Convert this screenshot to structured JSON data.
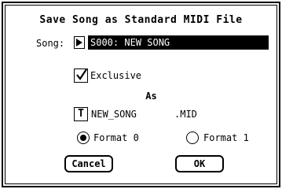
{
  "dialog": {
    "title": "Save Song as Standard MIDI File",
    "song_label": "Song:",
    "song_value": "S000: NEW SONG",
    "exclusive_label": "Exclusive",
    "exclusive_checked": true,
    "as_label": "As",
    "filename": "NEW_SONG",
    "extension": ".MID",
    "format0_label": "Format 0",
    "format1_label": "Format 1",
    "selected_format": "Format 0",
    "cancel_label": "Cancel",
    "ok_label": "OK"
  },
  "icons": {
    "song_select": "play-triangle-icon",
    "exclusive": "checkmark-icon",
    "filename_edit": "text-T-icon"
  }
}
